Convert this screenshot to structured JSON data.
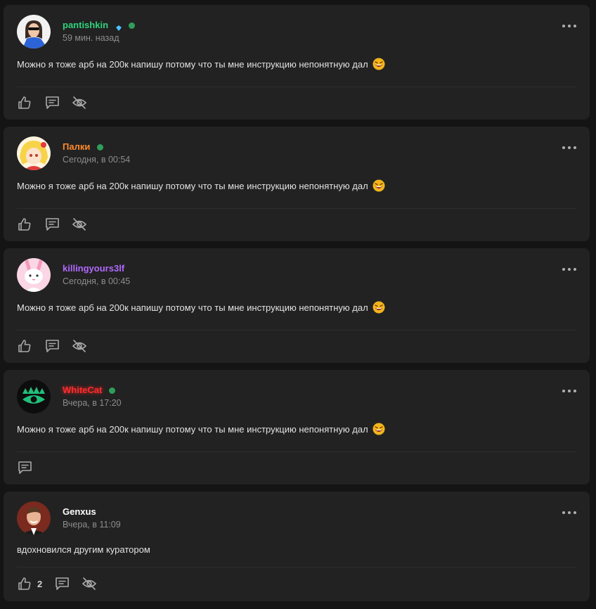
{
  "posts": [
    {
      "author": "pantishkin",
      "author_color": "#2fd47c",
      "has_gem_badge": true,
      "online": true,
      "time": "59 мин. назад",
      "text": "Можно я тоже арб на 200к напишу потому что ты мне инструкцию непонятную дал",
      "emoji": "laughing-emoji",
      "actions": [
        "like-icon",
        "reply-icon",
        "hide-icon"
      ],
      "likes": ""
    },
    {
      "author": "Палки",
      "author_color": "#ff8a2a",
      "has_gem_badge": false,
      "online": true,
      "time": "Сегодня, в 00:54",
      "text": "Можно я тоже арб на 200к напишу потому что ты мне инструкцию непонятную дал",
      "emoji": "laughing-emoji",
      "actions": [
        "like-icon",
        "reply-icon",
        "hide-icon"
      ],
      "likes": ""
    },
    {
      "author": "killingyours3lf",
      "author_color": "#b169ff",
      "has_gem_badge": false,
      "online": false,
      "time": "Сегодня, в 00:45",
      "text": "Можно я тоже арб на 200к напишу потому что ты мне инструкцию непонятную дал",
      "emoji": "laughing-emoji",
      "actions": [
        "like-icon",
        "reply-icon",
        "hide-icon"
      ],
      "likes": ""
    },
    {
      "author": "WhiteCat",
      "author_color": "#ff2b2b",
      "has_gem_badge": false,
      "online": true,
      "time": "Вчера, в 17:20",
      "text": "Можно я тоже арб на 200к напишу потому что ты мне инструкцию непонятную дал",
      "emoji": "laughing-emoji",
      "actions": [
        "reply-icon"
      ],
      "likes": ""
    },
    {
      "author": "Genxus",
      "author_color": "#ffffff",
      "has_gem_badge": false,
      "online": false,
      "time": "Вчера, в 11:09",
      "text": "вдохновился другим куратором",
      "emoji": "",
      "actions": [
        "like-icon",
        "reply-icon",
        "hide-icon"
      ],
      "likes": "2"
    }
  ]
}
